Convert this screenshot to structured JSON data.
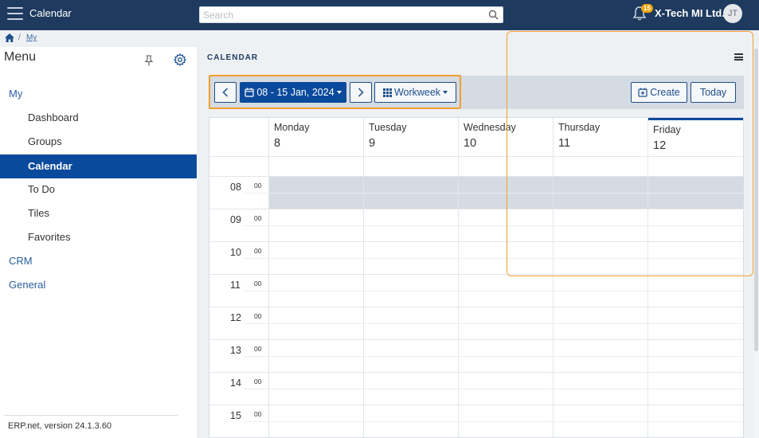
{
  "topbar": {
    "app_title": "Calendar",
    "search_placeholder": "Search",
    "notification_count": "15",
    "company": "X-Tech MI Ltd.",
    "avatar_initials": "JT"
  },
  "breadcrumb": {
    "separator": "/",
    "current": "My"
  },
  "sidebar": {
    "title": "Menu",
    "items": [
      {
        "label": "My",
        "level": "top",
        "active": false
      },
      {
        "label": "Dashboard",
        "level": "sub",
        "active": false
      },
      {
        "label": "Groups",
        "level": "sub",
        "active": false
      },
      {
        "label": "Calendar",
        "level": "sub",
        "active": true
      },
      {
        "label": "To Do",
        "level": "sub",
        "active": false
      },
      {
        "label": "Tiles",
        "level": "sub",
        "active": false
      },
      {
        "label": "Favorites",
        "level": "sub",
        "active": false
      },
      {
        "label": "CRM",
        "level": "top",
        "active": false
      },
      {
        "label": "General",
        "level": "top",
        "active": false
      }
    ],
    "version": "ERP.net, version 24.1.3.60"
  },
  "main": {
    "title": "CALENDAR",
    "toolbar": {
      "date_range": "08 - 15 Jan, 2024",
      "view": "Workweek",
      "create_label": "Create",
      "today_label": "Today"
    },
    "days": [
      {
        "name": "Monday",
        "num": "8",
        "today": false
      },
      {
        "name": "Tuesday",
        "num": "9",
        "today": false
      },
      {
        "name": "Wednesday",
        "num": "10",
        "today": false
      },
      {
        "name": "Thursday",
        "num": "11",
        "today": false
      },
      {
        "name": "Friday",
        "num": "12",
        "today": true
      }
    ],
    "hours": [
      "08",
      "09",
      "10",
      "11",
      "12",
      "13",
      "14",
      "15"
    ],
    "minutes": "00"
  },
  "colors": {
    "topbar": "#1e3a5f",
    "accent": "#0a4a9c",
    "highlight": "#f0a030"
  }
}
